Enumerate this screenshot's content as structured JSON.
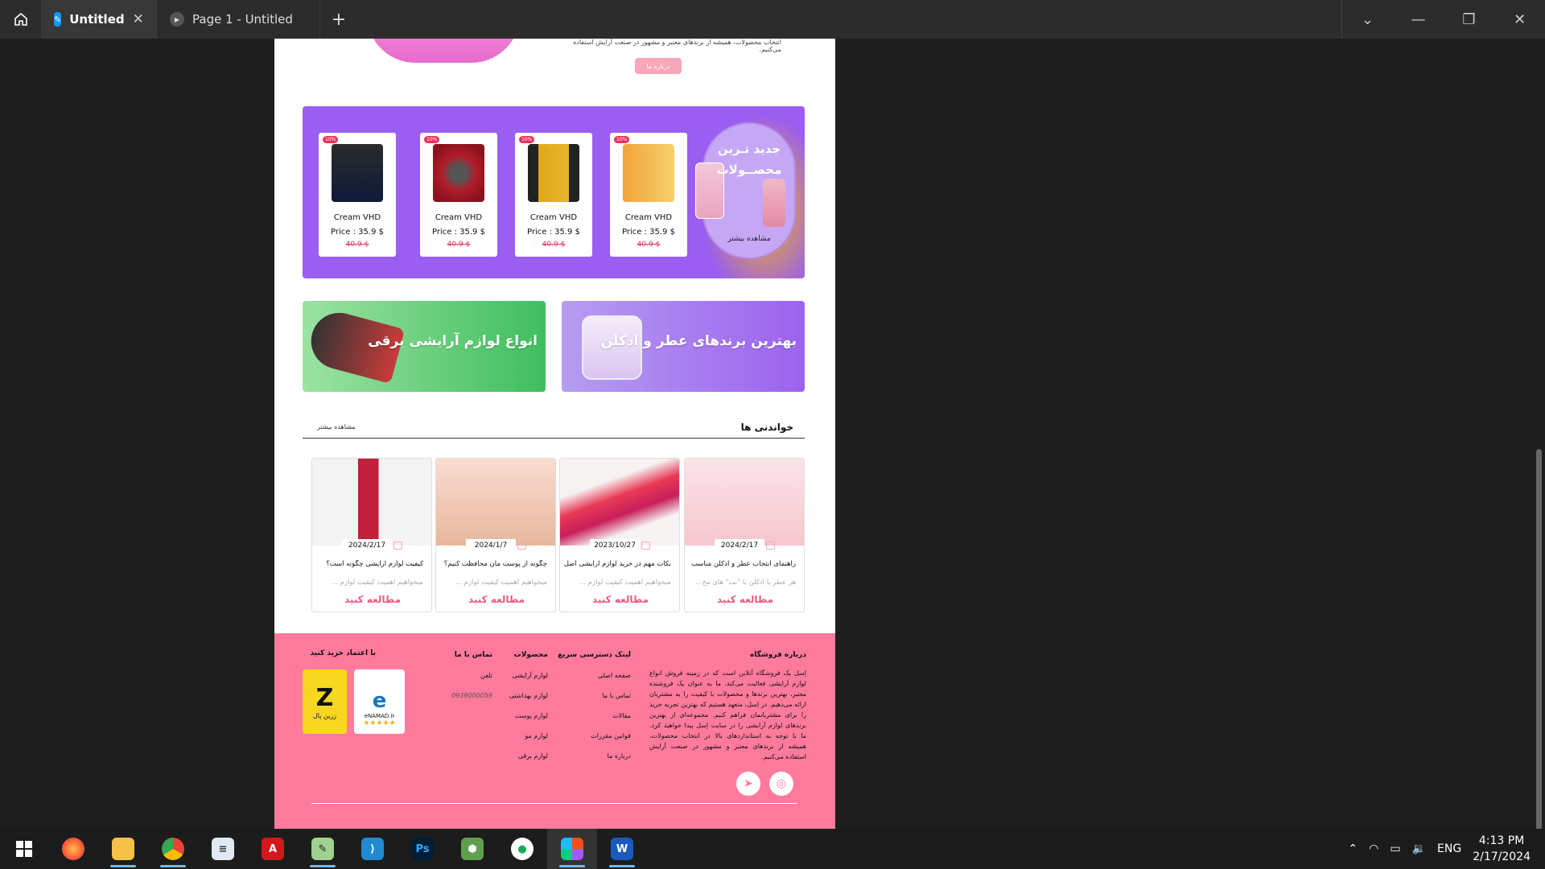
{
  "titlebar": {
    "tabs": [
      {
        "label": "Untitled",
        "active": true
      },
      {
        "label": "Page 1 - Untitled",
        "active": false
      }
    ],
    "new_tab": "+"
  },
  "hero": {
    "text": "انتخاب محصولات، همیشه از برندهای معتبر و مشهور در صنعت آرایش استفاده می‌کنیم.",
    "button": "درباره ما"
  },
  "promo": {
    "title_line1": "جدید تـرین",
    "title_line2": "محصــولات",
    "more": "مشاهده بیشتر",
    "products": [
      {
        "badge": "10%",
        "name": "Cream VHD",
        "price": "Price : 35.9 $",
        "old_price": "40.9 $",
        "color": "#111"
      },
      {
        "badge": "10%",
        "name": "Cream VHD",
        "price": "Price : 35.9 $",
        "old_price": "40.9 $",
        "color": "#b11c2a"
      },
      {
        "badge": "10%",
        "name": "Cream VHD",
        "price": "Price : 35.9 $",
        "old_price": "40.9 $",
        "color": "#e0a81a"
      },
      {
        "badge": "10%",
        "name": "Cream VHD",
        "price": "Price : 35.9 $",
        "old_price": "40.9 $",
        "color": "#f0b23a"
      }
    ]
  },
  "banners": {
    "green": "انواع لوازم آرایشی برقی",
    "purple": "بهترین برندهای عطر و ادکلن"
  },
  "reading": {
    "title": "خواندنی ها",
    "more": "مشاهده بیشتر",
    "articles": [
      {
        "date": "2024/2/17",
        "title": "راهنمای انتخاب عطر و ادکلن مناسب",
        "excerpt": "هر عطر یا ادکلن با \"نت\" های مخ...",
        "read": "مطالعه کنید",
        "color": "#f6c6cf"
      },
      {
        "date": "2023/10/27",
        "title": "نکات مهم در خرید لوازم آرایشی اصل",
        "excerpt": "میخواهیم اهمیت کیفیت لوازم ...",
        "read": "مطالعه کنید",
        "color": "#e83a55"
      },
      {
        "date": "2024/1/7",
        "title": "چگونه از پوست مان محافظت کنیم؟",
        "excerpt": "میخواهیم اهمیت کیفیت لوازم ...",
        "read": "مطالعه کنید",
        "color": "#f2c9b8"
      },
      {
        "date": "2024/2/17",
        "title": "کیفیت لوازم آرایشی چگونه است؟",
        "excerpt": "میخواهیم اهمیت کیفیت لوازم ...",
        "read": "مطالعه کنید",
        "color": "#f3f3f3"
      }
    ]
  },
  "footer": {
    "about_title": "درباره فروشگاه",
    "about_text": "اِسل یک فروشگاه آنلاین است که در زمینه فروش انواع لوازم آرایشی فعالیت می‌کند. ما به عنوان یک فروشنده معتبر، بهترین برندها و محصولات با کیفیت را به مشتریان ارائه می‌دهیم. در اِسل، متعهد هستیم که بهترین تجربه خرید را برای مشتریانمان فراهم کنیم. مجموعه‌ای از بهترین برندهای لوازم آرایشی را در سایت اِسل پیدا خواهید کرد. ما با توجه به استانداردهای بالا در انتخاب محصولات، همیشه از برندهای معتبر و مشهور در صنعت آرایش استفاده می‌کنیم.",
    "quick_title": "لینک دسترسی سریع",
    "quick_links": [
      "صفحه اصلی",
      "تماس با ما",
      "مقالات",
      "قوانین مقررات",
      "درباره ما"
    ],
    "products_title": "محصولات",
    "product_links": [
      "لوازم آرایشی",
      "لوازم بهداشتی",
      "لوازم پوست",
      "لوازم مو",
      "لوازم برقی"
    ],
    "contact_title": "تماس با ما",
    "phone_label": "تلفن",
    "phone": "0939000059",
    "trust_title": "با اعتماد خرید کنید",
    "enamad": "eNAMAD.ir",
    "zarinpal": "زرین پال"
  },
  "taskbar": {
    "apps": [
      "firefox",
      "file-explorer",
      "chrome",
      "notepad",
      "acrobat",
      "excel-like",
      "vscode",
      "photoshop",
      "nodejs",
      "mongodb",
      "figma",
      "word"
    ],
    "lang": "ENG",
    "time": "4:13 PM",
    "date": "2/17/2024"
  }
}
